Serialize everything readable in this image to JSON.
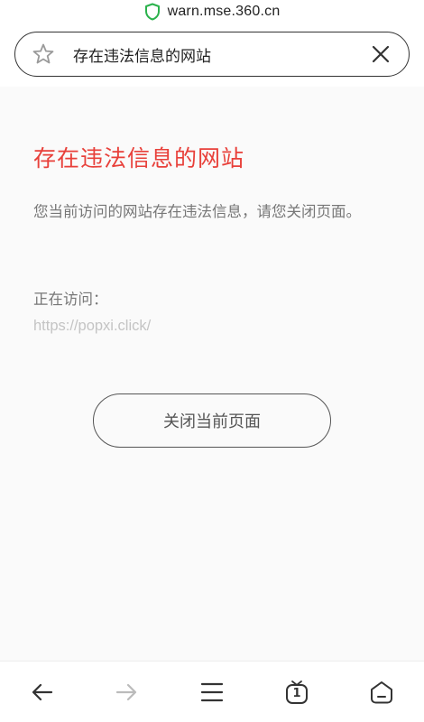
{
  "browser": {
    "url_host": "warn.mse.360.cn",
    "page_title": "存在违法信息的网站",
    "secure_color": "#2bb24c"
  },
  "content": {
    "heading": "存在违法信息的网站",
    "description": "您当前访问的网站存在违法信息，请您关闭页面。",
    "visiting_label": "正在访问：",
    "visiting_url": "https://popxi.click/",
    "close_button_label": "关闭当前页面",
    "accent_color": "#e8403a"
  },
  "bottom_nav": {
    "tab_count": "1",
    "items": [
      {
        "name": "back",
        "icon": "arrow-left-icon",
        "enabled": true
      },
      {
        "name": "forward",
        "icon": "arrow-right-icon",
        "enabled": false
      },
      {
        "name": "menu",
        "icon": "menu-icon",
        "enabled": true
      },
      {
        "name": "tabs",
        "icon": "tabs-icon",
        "enabled": true
      },
      {
        "name": "home",
        "icon": "home-icon",
        "enabled": true
      }
    ]
  }
}
